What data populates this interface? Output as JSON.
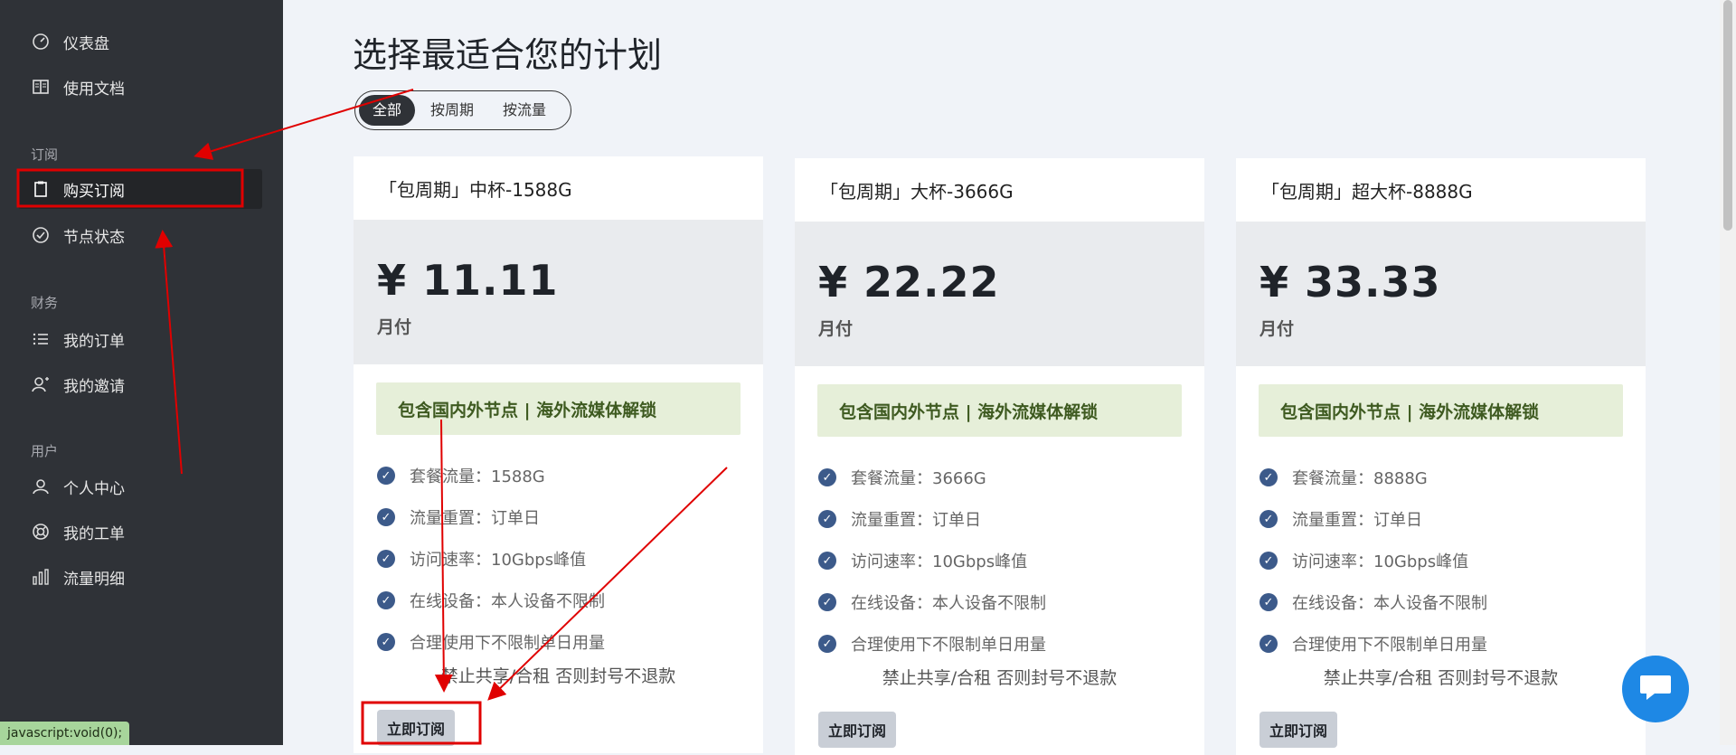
{
  "sidebar": {
    "items": [
      {
        "label": "仪表盘",
        "icon": "dashboard-icon"
      },
      {
        "label": "使用文档",
        "icon": "book-icon"
      },
      {
        "label": "购买订阅",
        "icon": "clipboard-icon"
      },
      {
        "label": "节点状态",
        "icon": "check-circle-icon"
      },
      {
        "label": "我的订单",
        "icon": "list-icon"
      },
      {
        "label": "我的邀请",
        "icon": "user-invite-icon"
      },
      {
        "label": "个人中心",
        "icon": "user-icon"
      },
      {
        "label": "我的工单",
        "icon": "lifebuoy-icon"
      },
      {
        "label": "流量明细",
        "icon": "bar-chart-icon"
      }
    ],
    "groups": {
      "subscribe": "订阅",
      "finance": "财务",
      "user": "用户"
    }
  },
  "status_bar": {
    "text": "javascript:void(0);"
  },
  "main": {
    "title": "选择最适合您的计划",
    "filters": [
      "全部",
      "按周期",
      "按流量"
    ]
  },
  "plans": [
    {
      "name": "「包周期」中杯-1588G",
      "price": "¥ 11.11",
      "period": "月付",
      "banner": "包含国内外节点 | 海外流媒体解锁",
      "features": [
        "套餐流量：1588G",
        "流量重置：订单日",
        "访问速率：10Gbps峰值",
        "在线设备：本人设备不限制",
        "合理使用下不限制单日用量"
      ],
      "note": "禁止共享/合租 否则封号不退款",
      "button": "立即订阅"
    },
    {
      "name": "「包周期」大杯-3666G",
      "price": "¥ 22.22",
      "period": "月付",
      "banner": "包含国内外节点 | 海外流媒体解锁",
      "features": [
        "套餐流量：3666G",
        "流量重置：订单日",
        "访问速率：10Gbps峰值",
        "在线设备：本人设备不限制",
        "合理使用下不限制单日用量"
      ],
      "note": "禁止共享/合租 否则封号不退款",
      "button": "立即订阅"
    },
    {
      "name": "「包周期」超大杯-8888G",
      "price": "¥ 33.33",
      "period": "月付",
      "banner": "包含国内外节点 | 海外流媒体解锁",
      "features": [
        "套餐流量：8888G",
        "流量重置：订单日",
        "访问速率：10Gbps峰值",
        "在线设备：本人设备不限制",
        "合理使用下不限制单日用量"
      ],
      "note": "禁止共享/合租 否则封号不退款",
      "button": "立即订阅"
    }
  ],
  "colors": {
    "sidebar_bg": "#2f3237",
    "accent_check": "#3c5a8a",
    "banner_bg": "#e6efd9",
    "banner_text": "#3e5a20",
    "annotation_red": "#e00000",
    "chat_blue": "#1e88e5"
  }
}
